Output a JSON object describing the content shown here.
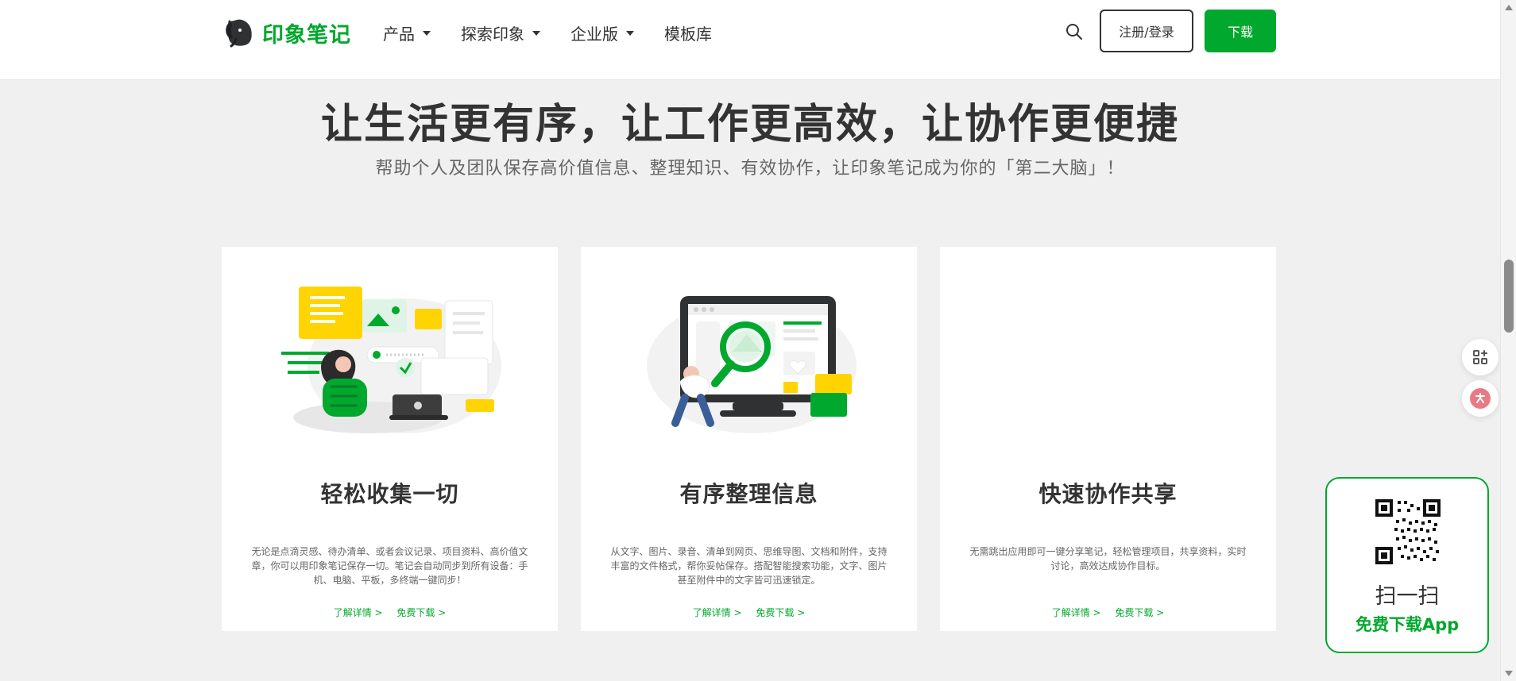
{
  "brand": {
    "name": "印象笔记",
    "accent": "#00a82d",
    "text": "#333333"
  },
  "header": {
    "nav": [
      {
        "label": "产品",
        "has_dropdown": true
      },
      {
        "label": "探索印象",
        "has_dropdown": true
      },
      {
        "label": "企业版",
        "has_dropdown": true
      },
      {
        "label": "模板库",
        "has_dropdown": false
      }
    ],
    "search_icon": "search-icon",
    "login_label": "注册/登录",
    "download_label": "下载"
  },
  "hero": {
    "title": "让生活更有序，让工作更高效，让协作更便捷",
    "subtitle": "帮助个人及团队保存高价值信息、整理知识、有效协作，让印象笔记成为你的「第二大脑」！"
  },
  "cards": [
    {
      "title": "轻松收集一切",
      "description": "无论是点滴灵感、待办清单、或者会议记录、项目资料、高价值文章，你可以用印象笔记保存一切。笔记会自动同步到所有设备：手机、电脑、平板，多终端一键同步！",
      "links": [
        "了解详情 >",
        "免费下载 >"
      ]
    },
    {
      "title": "有序整理信息",
      "description": "从文字、图片、录音、清单到网页、思维导图、文档和附件，支持丰富的文件格式，帮你妥帖保存。搭配智能搜索功能，文字、图片甚至附件中的文字皆可迅速锁定。",
      "links": [
        "了解详情 >",
        "免费下载 >"
      ]
    },
    {
      "title": "快速协作共享",
      "description": "无需跳出应用即可一键分享笔记，轻松管理项目，共享资料，实时讨论，高效达成协作目标。",
      "links": [
        "了解详情 >",
        "免费下载 >"
      ]
    }
  ],
  "floating": {
    "qr_scan": "扫一扫",
    "qr_download": "免费下载App"
  }
}
